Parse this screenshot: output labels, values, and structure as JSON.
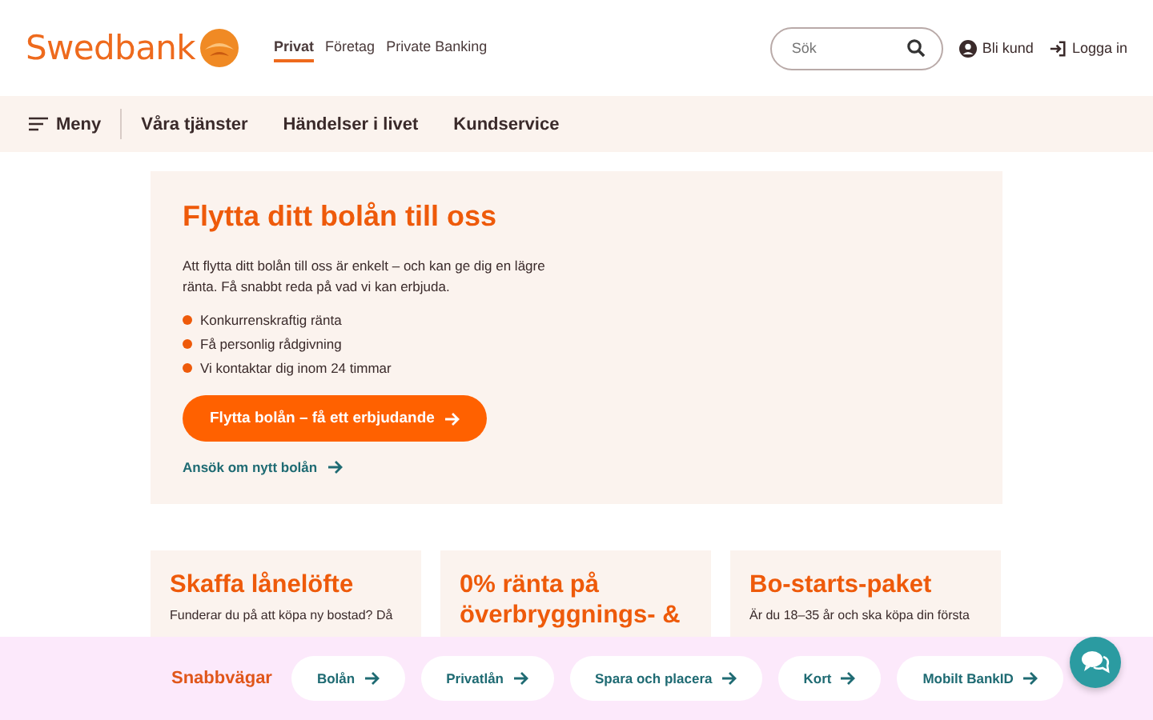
{
  "header": {
    "logo": "Swedbank",
    "segments": [
      {
        "label": "Privat",
        "selected": true
      },
      {
        "label": "Företag",
        "selected": false
      },
      {
        "label": "Private Banking",
        "selected": false
      }
    ],
    "search": {
      "placeholder": "Sök"
    },
    "actions": [
      {
        "kind": "user",
        "label": "Bli kund"
      },
      {
        "kind": "login",
        "label": "Logga in"
      }
    ]
  },
  "nav": {
    "menu": "Meny",
    "items": [
      "Våra tjänster",
      "Händelser i livet",
      "Kundservice"
    ]
  },
  "hero": {
    "title": "Flytta ditt bolån till oss",
    "text": "Att flytta ditt bolån till oss är enkelt – och kan ge dig en lägre ränta. Få snabbt reda på vad vi kan erbjuda.",
    "bullets": [
      "Konkurrenskraftig ränta",
      "Få personlig rådgivning",
      "Vi kontaktar dig inom 24 timmar"
    ],
    "button": "Flytta bolån – få ett erbjudande",
    "link": "Ansök om nytt bolån"
  },
  "cards": [
    {
      "title": "Skaffa lånelöfte",
      "text": "Funderar du på att köpa ny bostad? Då"
    },
    {
      "title": "0% ränta på överbryggnings- &"
    },
    {
      "title": "Bo-starts-paket",
      "text": "Är du 18–35 år och ska köpa din första"
    }
  ],
  "quicklinks": {
    "label": "Snabbvägar",
    "items": [
      "Bolån",
      "Privatlån",
      "Spara och placera",
      "Kort",
      "Mobilt BankID"
    ]
  }
}
